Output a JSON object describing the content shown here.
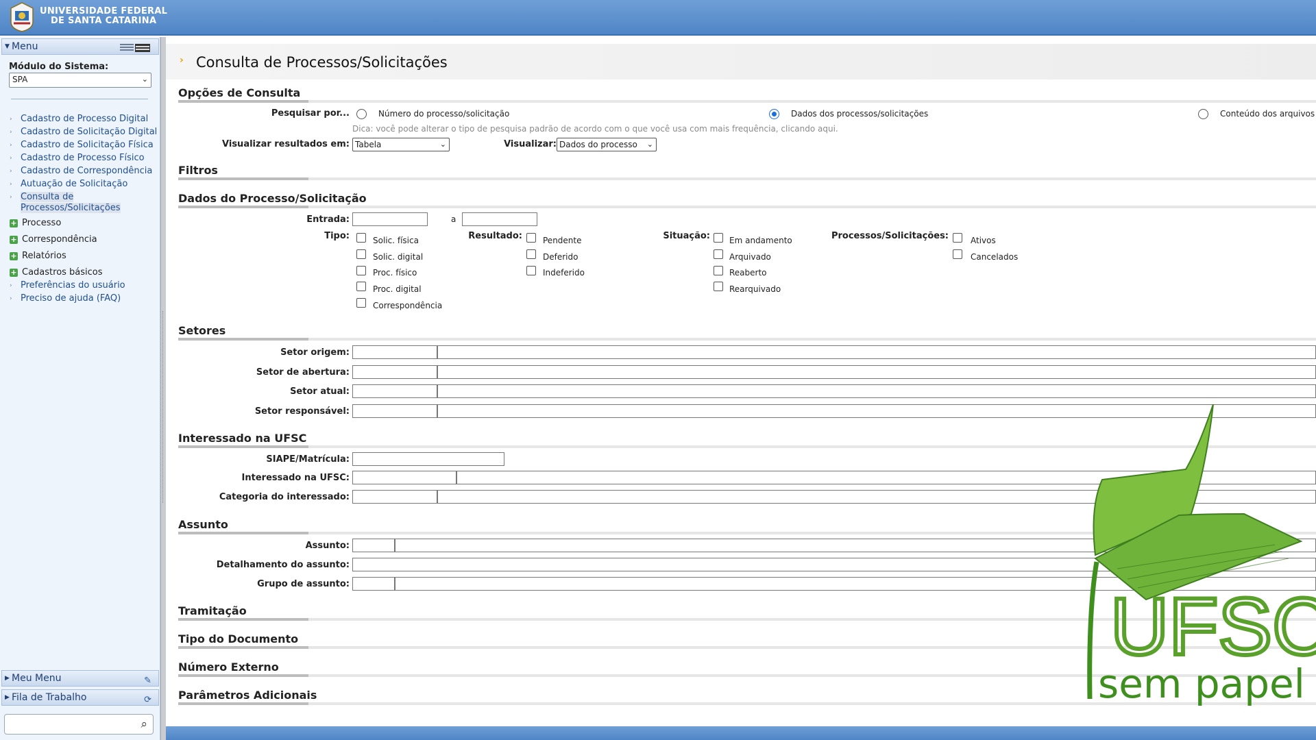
{
  "header": {
    "university_line1": "UNIVERSIDADE FEDERAL",
    "university_line2": "DE SANTA CATARINA"
  },
  "sidebar": {
    "menu_title": "Menu",
    "module_label": "Módulo do Sistema:",
    "module_value": "SPA",
    "links": [
      "Cadastro de Processo Digital",
      "Cadastro de Solicitação Digital",
      "Cadastro de Solicitação Física",
      "Cadastro de Processo Físico",
      "Cadastro de Correspondência",
      "Autuação de Solicitação"
    ],
    "active_link_line1": "Consulta de",
    "active_link_line2": "Processos/Solicitações",
    "groups": [
      "Processo",
      "Correspondência",
      "Relatórios",
      "Cadastros básicos"
    ],
    "extra_links": [
      "Preferências do usuário",
      "Preciso de ajuda (FAQ)"
    ],
    "meu_menu": "Meu Menu",
    "fila_trabalho": "Fila de Trabalho",
    "search_value": ""
  },
  "main": {
    "title": "Consulta de Processos/Solicitações",
    "opcoes": {
      "heading": "Opções de Consulta",
      "pesquisar_label": "Pesquisar por...",
      "radio_numero": "Número do processo/solicitação",
      "radio_dados": "Dados dos processos/solicitações",
      "radio_conteudo": "Conteúdo dos arquivos",
      "selected_radio": "Dados dos processos/solicitações",
      "hint": "Dica: você pode alterar o tipo de pesquisa padrão de acordo com o que você usa com mais frequência, clicando aqui.",
      "visualizar_resultados_label": "Visualizar resultados em:",
      "visualizar_resultados_value": "Tabela",
      "visualizar_label": "Visualizar:",
      "visualizar_value": "Dados do processo"
    },
    "filtros_heading": "Filtros",
    "dados": {
      "heading": "Dados do Processo/Solicitação",
      "entrada_label": "Entrada:",
      "a_label": "a",
      "tipo_label": "Tipo:",
      "tipo_options": [
        "Solic. física",
        "Solic. digital",
        "Proc. físico",
        "Proc. digital",
        "Correspondência"
      ],
      "resultado_label": "Resultado:",
      "resultado_options": [
        "Pendente",
        "Deferido",
        "Indeferido"
      ],
      "situacao_label": "Situação:",
      "situacao_options": [
        "Em andamento",
        "Arquivado",
        "Reaberto",
        "Rearquivado"
      ],
      "processos_label": "Processos/Solicitações:",
      "processos_options": [
        "Ativos",
        "Cancelados"
      ]
    },
    "setores": {
      "heading": "Setores",
      "labels": [
        "Setor origem:",
        "Setor de abertura:",
        "Setor atual:",
        "Setor responsável:"
      ]
    },
    "interessado": {
      "heading": "Interessado na UFSC",
      "siape_label": "SIAPE/Matrícula:",
      "interessado_label": "Interessado na UFSC:",
      "categoria_label": "Categoria do interessado:"
    },
    "assunto": {
      "heading": "Assunto",
      "assunto_label": "Assunto:",
      "detalhamento_label": "Detalhamento do assunto:",
      "grupo_label": "Grupo de assunto:"
    },
    "collapsed_sections": [
      "Tramitação",
      "Tipo do Documento",
      "Número Externo",
      "Parâmetros Adicionais"
    ]
  },
  "watermark": {
    "line1": "UFSC",
    "line2": "sem papel"
  },
  "colors": {
    "header_blue": "#4f85c6",
    "accent_orange": "#e8a000",
    "watermark_green": "#5aa12b"
  }
}
